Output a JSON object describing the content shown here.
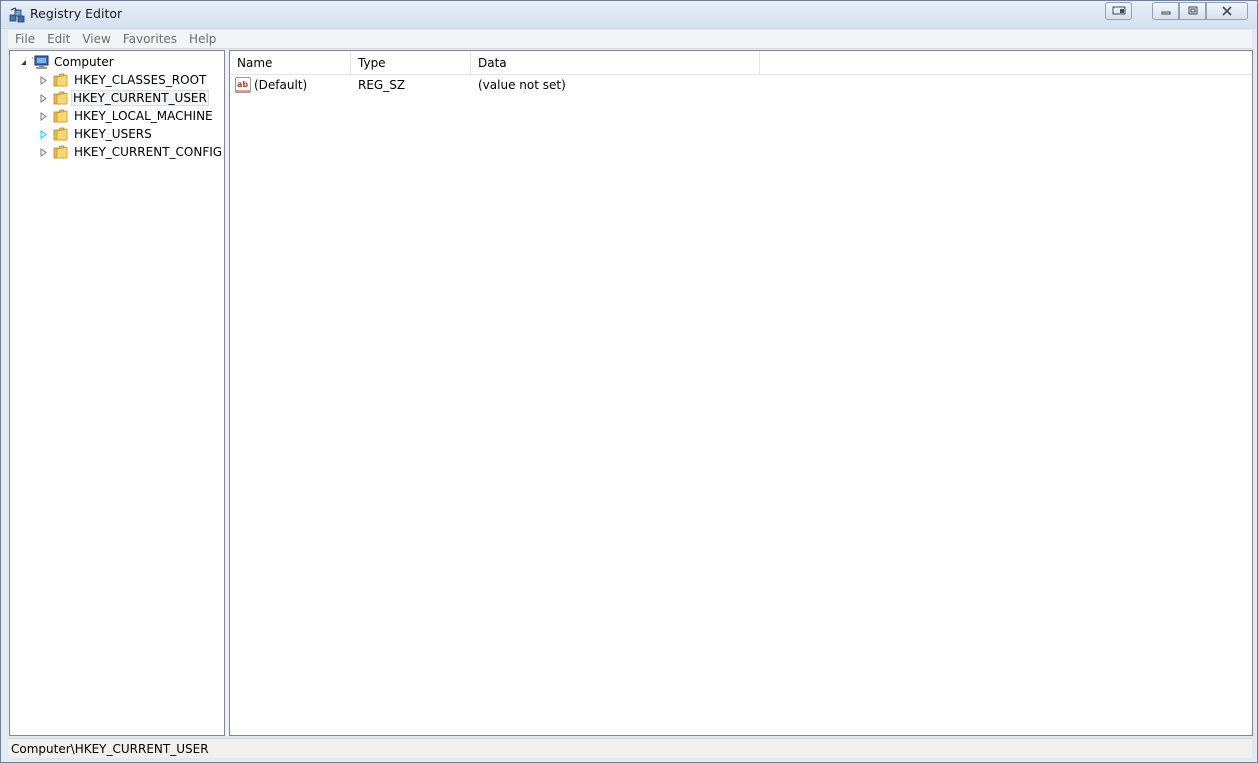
{
  "window": {
    "title": "Registry Editor",
    "app_icon": "registry-editor-icon"
  },
  "titlebar_buttons": {
    "extra": "screen-icon",
    "minimize": "minimize-icon",
    "maximize": "maximize-icon",
    "close": "close-icon"
  },
  "menu": {
    "items": [
      "File",
      "Edit",
      "View",
      "Favorites",
      "Help"
    ]
  },
  "tree": {
    "root": {
      "label": "Computer",
      "icon": "computer-icon",
      "expanded": true
    },
    "items": [
      {
        "label": "HKEY_CLASSES_ROOT",
        "icon": "folder-icon",
        "selected": false
      },
      {
        "label": "HKEY_CURRENT_USER",
        "icon": "folder-icon",
        "selected": true
      },
      {
        "label": "HKEY_LOCAL_MACHINE",
        "icon": "folder-icon",
        "selected": false
      },
      {
        "label": "HKEY_USERS",
        "icon": "folder-icon",
        "selected": false
      },
      {
        "label": "HKEY_CURRENT_CONFIG",
        "icon": "folder-icon",
        "selected": false
      }
    ]
  },
  "list": {
    "columns": [
      "Name",
      "Type",
      "Data"
    ],
    "rows": [
      {
        "icon": "string-value-icon",
        "name": "(Default)",
        "type": "REG_SZ",
        "data": "(value not set)"
      }
    ]
  },
  "status": {
    "path": "Computer\\HKEY_CURRENT_USER"
  },
  "colors": {
    "folder": "#f3cf5f",
    "hover_expander": "#1cc4f7"
  }
}
